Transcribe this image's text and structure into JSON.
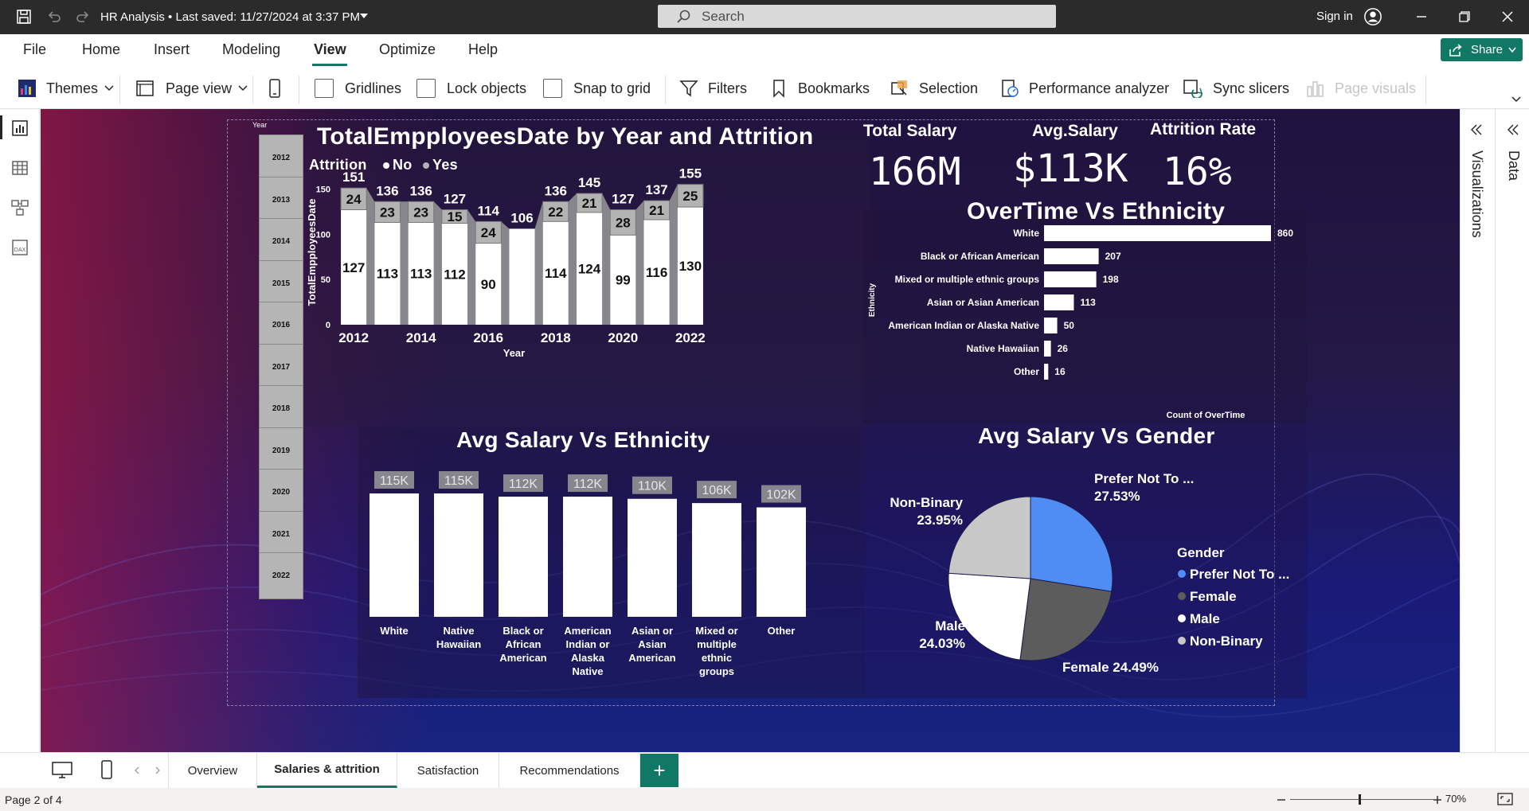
{
  "titlebar": {
    "title": "HR Analysis  •  Last saved: 11/27/2024 at 3:37 PM",
    "search_placeholder": "Search",
    "signin": "Sign in"
  },
  "ribbon": {
    "tabs": [
      "File",
      "Home",
      "Insert",
      "Modeling",
      "View",
      "Optimize",
      "Help"
    ],
    "active_tab": "View",
    "share_label": "Share",
    "tools": {
      "themes": "Themes",
      "page_view": "Page view",
      "gridlines": "Gridlines",
      "lock_objects": "Lock objects",
      "snap_to_grid": "Snap to grid",
      "filters": "Filters",
      "bookmarks": "Bookmarks",
      "selection": "Selection",
      "performance_analyzer": "Performance analyzer",
      "sync_slicers": "Sync slicers",
      "page_visuals": "Page visuals"
    }
  },
  "panes": {
    "visualizations": "Visualizations",
    "data": "Data"
  },
  "slicer": {
    "title": "Year",
    "items": [
      "2012",
      "2013",
      "2014",
      "2015",
      "2016",
      "2017",
      "2018",
      "2019",
      "2020",
      "2021",
      "2022"
    ]
  },
  "kpis": [
    {
      "label": "Total Salary",
      "value": "166M"
    },
    {
      "label": "Avg.Salary",
      "value": "$113K"
    },
    {
      "label": "Attrition Rate",
      "value": "16%"
    }
  ],
  "colors": {
    "bar_no": "#ffffff",
    "bar_yes": "#b3b3b3",
    "ribbon_fill": "#9a9a9a",
    "pie_prefer_not": "#4f8df5",
    "pie_female": "#5c5c5c",
    "pie_male": "#ffffff",
    "pie_nonbinary": "#c8c8c8",
    "accent": "#117865"
  },
  "chart_data": [
    {
      "type": "bar",
      "title": "TotalEmpployeesDate by Year and Attrition",
      "legend_title": "Attrition",
      "xlabel": "Year",
      "ylabel": "TotalEmpployeesDate",
      "x_tick_labels": [
        "2012",
        "2014",
        "2016",
        "2018",
        "2020",
        "2022"
      ],
      "y_ticks": [
        0,
        50,
        100,
        150
      ],
      "ylim": [
        0,
        160
      ],
      "categories": [
        "2012",
        "2013",
        "2014",
        "2015",
        "2016",
        "2017",
        "2018",
        "2019",
        "2020",
        "2021",
        "2022"
      ],
      "series": [
        {
          "name": "No",
          "values": [
            127,
            113,
            113,
            112,
            90,
            106,
            114,
            124,
            99,
            116,
            130
          ],
          "labels": [
            "127",
            "113",
            "113",
            "112",
            "90",
            "",
            "114",
            "124",
            "99",
            "116",
            "130"
          ]
        },
        {
          "name": "Yes",
          "values": [
            24,
            23,
            23,
            15,
            24,
            0,
            22,
            21,
            28,
            21,
            25
          ],
          "labels": [
            "24",
            "23",
            "23",
            "15",
            "24",
            "",
            "22",
            "21",
            "28",
            "21",
            "25"
          ]
        }
      ],
      "totals": [
        151,
        136,
        136,
        127,
        114,
        106,
        136,
        145,
        127,
        137,
        155
      ],
      "legend": "top-left"
    },
    {
      "type": "bar",
      "orientation": "horizontal",
      "title": "OverTime Vs Ethnicity",
      "xlabel": "Count of OverTime",
      "ylabel": "Ethnicity",
      "categories": [
        "White",
        "Black or African American",
        "Mixed or multiple ethnic groups",
        "Asian or Asian American",
        "American Indian or Alaska Native",
        "Native Hawaiian",
        "Other"
      ],
      "values": [
        860,
        207,
        198,
        113,
        50,
        26,
        16
      ],
      "xlim": [
        0,
        860
      ]
    },
    {
      "type": "bar",
      "title": "Avg Salary Vs Ethnicity",
      "categories": [
        "White",
        "Native Hawaiian",
        "Black or African American",
        "American Indian or Alaska Native",
        "Asian or Asian American",
        "Mixed or multiple ethnic groups",
        "Other"
      ],
      "category_lines": [
        [
          "White"
        ],
        [
          "Native",
          "Hawaiian"
        ],
        [
          "Black or",
          "African",
          "American"
        ],
        [
          "American",
          "Indian or",
          "Alaska",
          "Native"
        ],
        [
          "Asian or",
          "Asian",
          "American"
        ],
        [
          "Mixed or",
          "multiple",
          "ethnic",
          "groups"
        ],
        [
          "Other"
        ]
      ],
      "values": [
        115,
        115,
        112,
        112,
        110,
        106,
        102
      ],
      "labels": [
        "115K",
        "115K",
        "112K",
        "112K",
        "110K",
        "106K",
        "102K"
      ],
      "ylim": [
        0,
        115
      ]
    },
    {
      "type": "pie",
      "title": "Avg Salary Vs Gender",
      "legend_title": "Gender",
      "legend": "right",
      "slices": [
        {
          "name": "Prefer Not To ...",
          "value": 27.53,
          "label": "27.53%"
        },
        {
          "name": "Female",
          "value": 24.49,
          "label": "24.49%"
        },
        {
          "name": "Male",
          "value": 24.03,
          "label": "24.03%"
        },
        {
          "name": "Non-Binary",
          "value": 23.95,
          "label": "23.95%"
        }
      ]
    }
  ],
  "page_tabs": [
    "Overview",
    "Salaries & attrition",
    "Satisfaction",
    "Recommendations"
  ],
  "active_page_tab": "Salaries & attrition",
  "status": {
    "page": "Page 2 of 4",
    "zoom": "70%"
  }
}
